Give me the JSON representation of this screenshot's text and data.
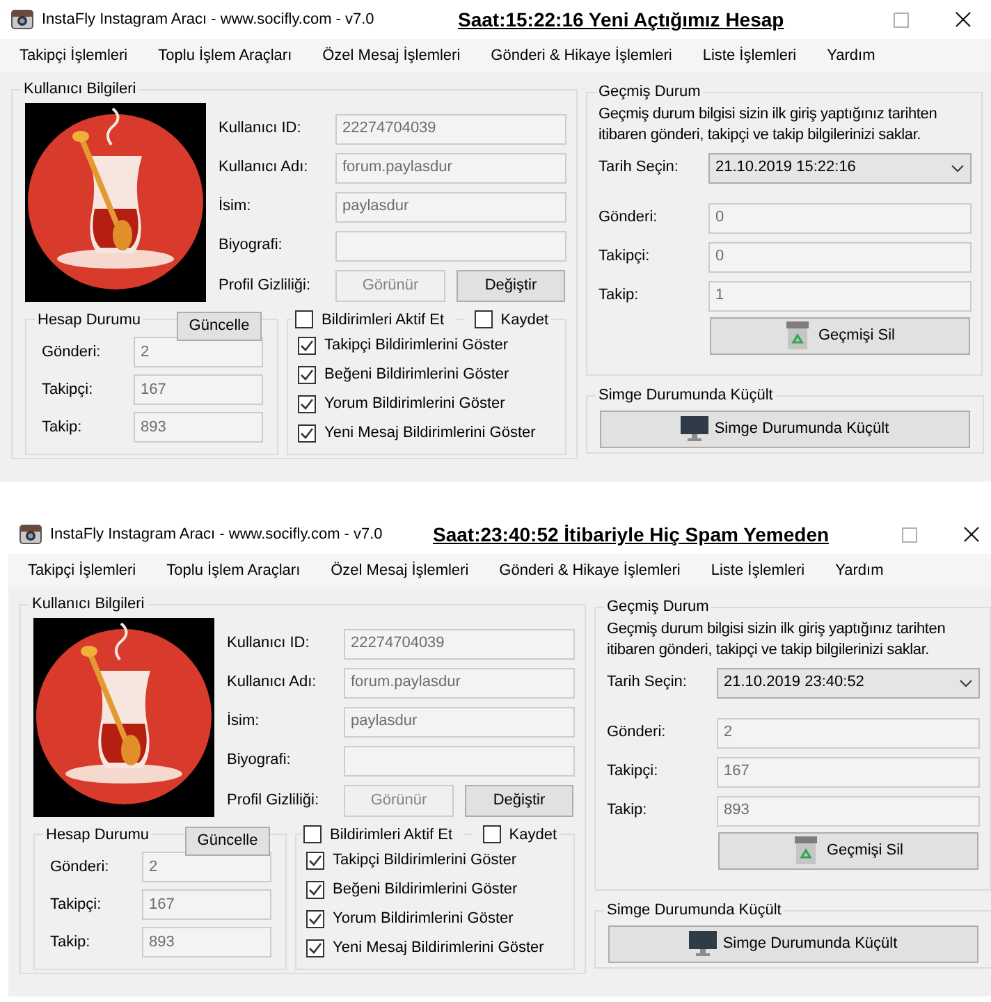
{
  "windows": [
    {
      "title": "InstaFly Instagram Aracı - www.socifly.com - v7.0",
      "caption": "Saat:15:22:16 Yeni Açtığımız Hesap",
      "menu": [
        "Takipçi İşlemleri",
        "Toplu İşlem Araçları",
        "Özel Mesaj İşlemleri",
        "Gönderi & Hikaye İşlemleri",
        "Liste İşlemleri",
        "Yardım"
      ],
      "user_info": {
        "title": "Kullanıcı Bilgileri",
        "fields": [
          {
            "label": "Kullanıcı ID:",
            "value": "22274704039"
          },
          {
            "label": "Kullanıcı Adı:",
            "value": "forum.paylasdur"
          },
          {
            "label": "İsim:",
            "value": "paylasdur"
          },
          {
            "label": "Biyografi:"
          }
        ],
        "privacy": {
          "label": "Profil Gizliliği:",
          "buttons": [
            {
              "label": "Görünür",
              "disabled": true
            },
            {
              "label": "Değiştir",
              "disabled": false
            }
          ]
        }
      },
      "account_status": {
        "title": "Hesap Durumu",
        "button": "Güncelle",
        "fields": [
          {
            "label": "Gönderi:",
            "value": "2"
          },
          {
            "label": "Takipçi:",
            "value": "167"
          },
          {
            "label": "Takip:",
            "value": "893"
          }
        ]
      },
      "notifications": {
        "header": [
          {
            "label": "Bildirimleri Aktif Et",
            "checked": false
          },
          {
            "label": "Kaydet",
            "checked": false
          }
        ],
        "items": [
          {
            "label": "Takipçi Bildirimlerini Göster",
            "checked": true
          },
          {
            "label": "Beğeni Bildirimlerini Göster",
            "checked": true
          },
          {
            "label": "Yorum Bildirimlerini Göster",
            "checked": true
          },
          {
            "label": "Yeni Mesaj Bildirimlerini Göster",
            "checked": true
          }
        ]
      },
      "history": {
        "title": "Geçmiş Durum",
        "description": "Geçmiş durum bilgisi sizin ilk giriş yaptığınız tarihten itibaren gönderi, takipçi ve takip bilgilerinizi saklar.",
        "date_label": "Tarih Seçin:",
        "date_value": "21.10.2019 15:22:16",
        "fields": [
          {
            "label": "Gönderi:",
            "value": "0"
          },
          {
            "label": "Takipçi:",
            "value": "0"
          },
          {
            "label": "Takip:",
            "value": "1"
          }
        ],
        "button": "Geçmişi Sil"
      },
      "minimize": {
        "title": "Simge Durumunda Küçült",
        "button": "Simge Durumunda Küçült"
      }
    },
    {
      "title": "InstaFly Instagram Aracı - www.socifly.com - v7.0",
      "caption": "Saat:23:40:52 İtibariyle Hiç Spam Yemeden",
      "menu": [
        "Takipçi İşlemleri",
        "Toplu İşlem Araçları",
        "Özel Mesaj İşlemleri",
        "Gönderi & Hikaye İşlemleri",
        "Liste İşlemleri",
        "Yardım"
      ],
      "user_info": {
        "title": "Kullanıcı Bilgileri",
        "fields": [
          {
            "label": "Kullanıcı ID:",
            "value": "22274704039"
          },
          {
            "label": "Kullanıcı Adı:",
            "value": "forum.paylasdur"
          },
          {
            "label": "İsim:",
            "value": "paylasdur"
          },
          {
            "label": "Biyografi:"
          }
        ],
        "privacy": {
          "label": "Profil Gizliliği:",
          "buttons": [
            {
              "label": "Görünür",
              "disabled": true
            },
            {
              "label": "Değiştir",
              "disabled": false
            }
          ]
        }
      },
      "account_status": {
        "title": "Hesap Durumu",
        "button": "Güncelle",
        "fields": [
          {
            "label": "Gönderi:",
            "value": "2"
          },
          {
            "label": "Takipçi:",
            "value": "167"
          },
          {
            "label": "Takip:",
            "value": "893"
          }
        ]
      },
      "notifications": {
        "header": [
          {
            "label": "Bildirimleri Aktif Et",
            "checked": false
          },
          {
            "label": "Kaydet",
            "checked": false
          }
        ],
        "items": [
          {
            "label": "Takipçi Bildirimlerini Göster",
            "checked": true
          },
          {
            "label": "Beğeni Bildirimlerini Göster",
            "checked": true
          },
          {
            "label": "Yorum Bildirimlerini Göster",
            "checked": true
          },
          {
            "label": "Yeni Mesaj Bildirimlerini Göster",
            "checked": true
          }
        ]
      },
      "history": {
        "title": "Geçmiş Durum",
        "description": "Geçmiş durum bilgisi sizin ilk giriş yaptığınız tarihten itibaren gönderi, takipçi ve takip bilgilerinizi saklar.",
        "date_label": "Tarih Seçin:",
        "date_value": "21.10.2019 23:40:52",
        "fields": [
          {
            "label": "Gönderi:",
            "value": "2"
          },
          {
            "label": "Takipçi:",
            "value": "167"
          },
          {
            "label": "Takip:",
            "value": "893"
          }
        ],
        "button": "Geçmişi Sil"
      },
      "minimize": {
        "title": "Simge Durumunda Küçült",
        "button": "Simge Durumunda Küçült"
      }
    }
  ]
}
